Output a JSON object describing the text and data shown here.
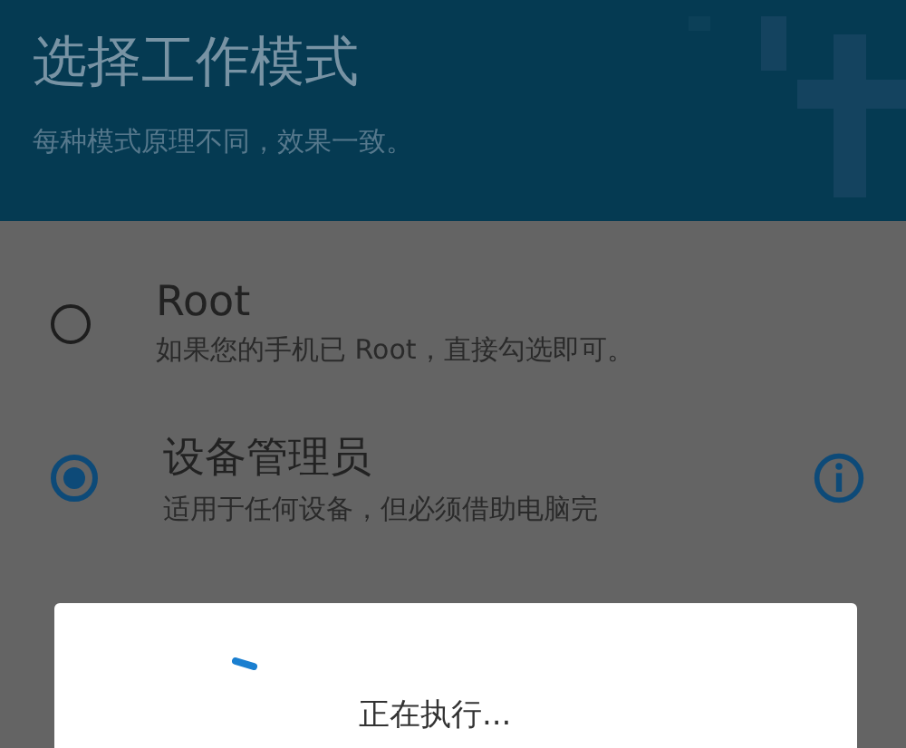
{
  "header": {
    "title": "选择工作模式",
    "subtitle": "每种模式原理不同，效果一致。"
  },
  "modes": [
    {
      "title": "Root",
      "description": "如果您的手机已 Root，直接勾选即可。",
      "selected": false,
      "info": false
    },
    {
      "title": "设备管理员",
      "description": "适用于任何设备，但必须借助电脑完",
      "selected": true,
      "info": true
    }
  ],
  "dialog": {
    "message": "正在执行..."
  }
}
